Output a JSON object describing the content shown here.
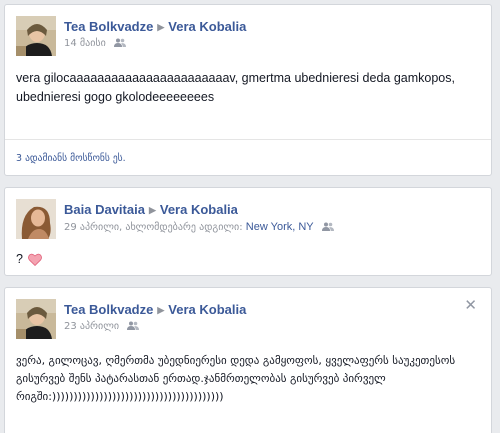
{
  "posts": [
    {
      "author": "Tea Bolkvadze",
      "target": "Vera Kobalia",
      "date": "14 მაისი",
      "text": "vera gilocaaaaaaaaaaaaaaaaaaaaaaav, gmertma ubednieresi deda gamkopos, ubednieresi gogo gkolodeeeeeeees",
      "likes": "3 ადამიანს მოსწონს ეს."
    },
    {
      "author": "Baia Davitaia",
      "target": "Vera Kobalia",
      "date": "29 აპრილი",
      "location_prefix": ", ახლომდებარე ადგილი:",
      "location": "New York, NY",
      "text": "?"
    },
    {
      "author": "Tea Bolkvadze",
      "target": "Vera Kobalia",
      "date": "23 აპრილი",
      "text": "ვერა, გილოცავ, ღმერთმა უბედნიერესი დედა გამყოფოს, ყველაფერს საუკეთესოს გისურვებ შენს პატარასთან ერთად.ჯანმრთელობას გისურვებ პირველ რიგში:))))))))))))))))))))))))))))))))))))))))"
    }
  ],
  "icons": {
    "audience": "friends-icon",
    "heart": "heart-icon",
    "close": "close-icon"
  }
}
